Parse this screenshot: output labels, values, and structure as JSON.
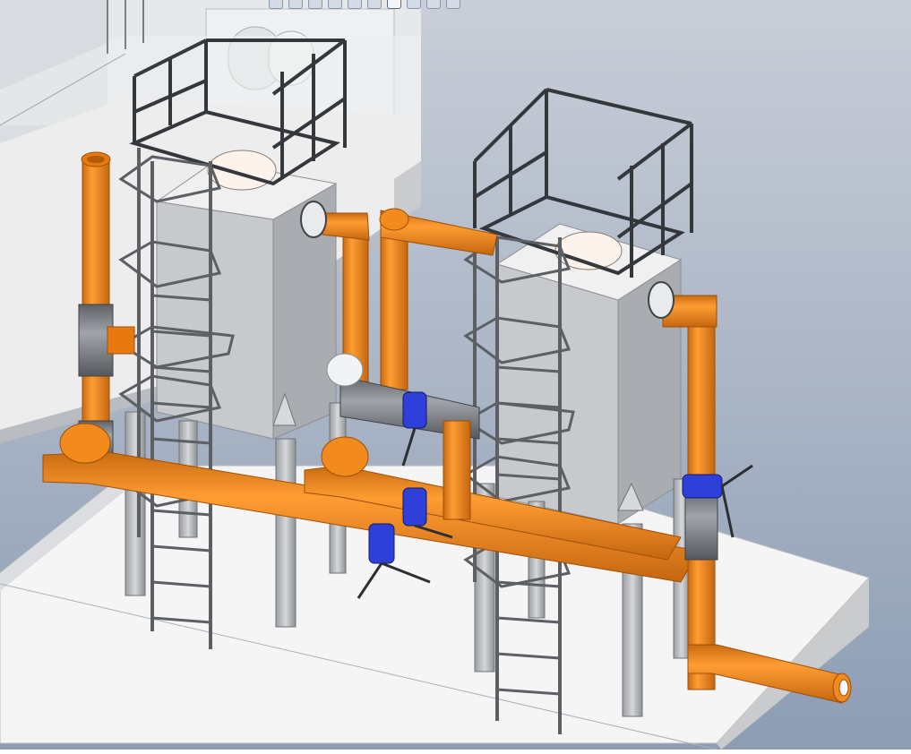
{
  "app": {
    "title": "",
    "colors": {
      "background_top": "#c6ccd6",
      "background_bottom": "#8f9fb6",
      "pipe_orange": "#f28a1e",
      "pipe_orange_dark": "#c96a10",
      "pipe_gray": "#7f8288",
      "valve_blue": "#2f3fd9",
      "tank_face": "#c4c6c9",
      "tank_side": "#a7aaae",
      "tank_top": "#ececec",
      "platform": "#f4f4f4",
      "railing": "#3a3d42",
      "ladder": "#6b6e73"
    }
  },
  "toolbar": {
    "items": [
      {
        "icon": "zoom-icon"
      },
      {
        "icon": "rotate-icon"
      },
      {
        "icon": "pan-icon"
      },
      {
        "icon": "section-view-icon"
      },
      {
        "icon": "view-orientation-icon"
      },
      {
        "icon": "display-style-icon"
      },
      {
        "icon": "hide-show-icon"
      },
      {
        "icon": "appearance-icon"
      },
      {
        "icon": "scene-icon"
      },
      {
        "icon": "view-settings-icon"
      }
    ]
  },
  "model": {
    "components": [
      "tank-left",
      "tank-right",
      "ladder-left",
      "ladder-right",
      "railing-left",
      "railing-right",
      "header-pipe-front",
      "header-pipe-middle",
      "riser-left",
      "riser-middle",
      "riser-right",
      "outlet-pipe",
      "butterfly-valve-1",
      "butterfly-valve-2",
      "butterfly-valve-3",
      "butterfly-valve-4"
    ]
  }
}
